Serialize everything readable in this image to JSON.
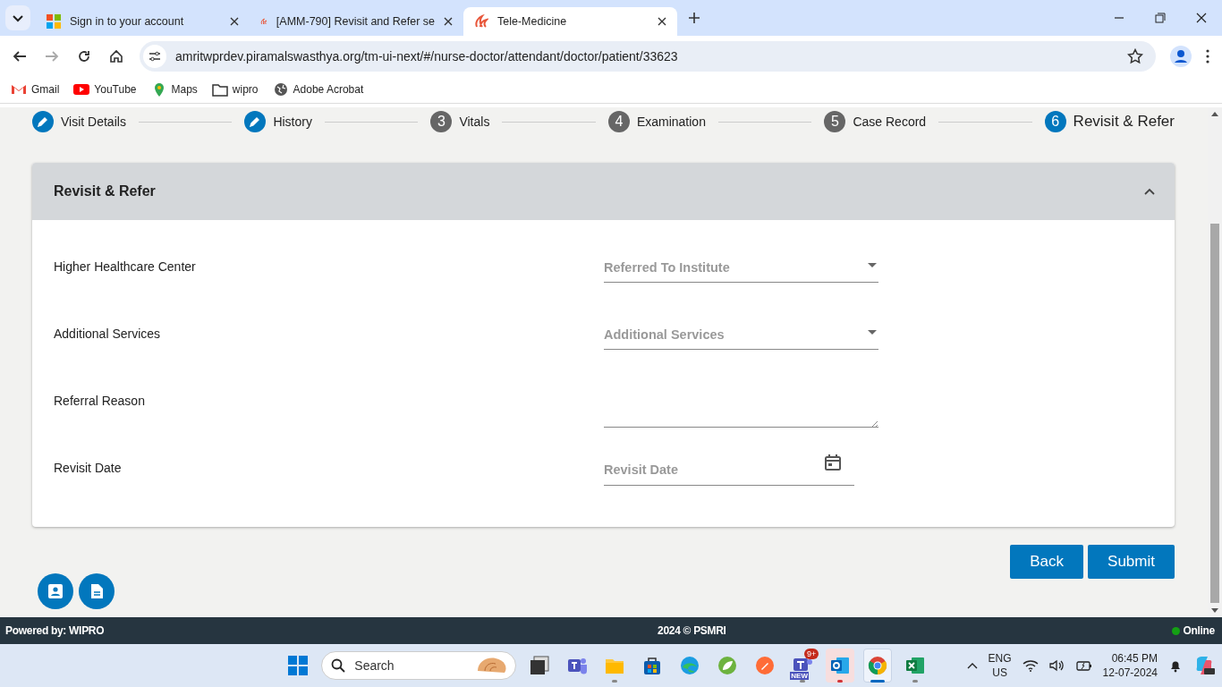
{
  "browser": {
    "tabs": [
      {
        "title": "Sign in to your account",
        "selected": false
      },
      {
        "title": "[AMM-790] Revisit and Refer se",
        "selected": false
      },
      {
        "title": "Tele-Medicine",
        "selected": true
      }
    ],
    "url": "amritwprdev.piramalswasthya.org/tm-ui-next/#/nurse-doctor/attendant/doctor/patient/33623",
    "bookmarks": [
      {
        "label": "Gmail"
      },
      {
        "label": "YouTube"
      },
      {
        "label": "Maps"
      },
      {
        "label": "wipro"
      },
      {
        "label": "Adobe Acrobat"
      }
    ]
  },
  "stepper": [
    {
      "label": "Visit Details",
      "completed": true,
      "selected": false
    },
    {
      "label": "History",
      "completed": true,
      "selected": false
    },
    {
      "label": "Vitals",
      "number": "3",
      "completed": false,
      "selected": false
    },
    {
      "label": "Examination",
      "number": "4",
      "completed": false,
      "selected": false
    },
    {
      "label": "Case Record",
      "number": "5",
      "completed": false,
      "selected": false
    },
    {
      "label": "Revisit & Refer",
      "number": "6",
      "completed": false,
      "selected": true
    }
  ],
  "panel": {
    "title": "Revisit & Refer",
    "expanded": true,
    "fields": [
      {
        "label": "Higher Healthcare Center",
        "kind": "select",
        "placeholder": "Referred To Institute"
      },
      {
        "label": "Additional Services",
        "kind": "select",
        "placeholder": "Additional Services"
      },
      {
        "label": "Referral Reason",
        "kind": "textarea"
      },
      {
        "label": "Revisit Date",
        "kind": "date",
        "placeholder": "Revisit Date"
      }
    ]
  },
  "buttons": [
    "Back",
    "Submit"
  ],
  "footer": {
    "left": "Powered by: WIPRO",
    "center": "2024 © PSMRI",
    "status": "Online",
    "online": true
  },
  "taskbar": {
    "search_placeholder": "Search",
    "apps": [
      {
        "running": false,
        "selected": false,
        "attention": false
      },
      {
        "running": false,
        "selected": false,
        "attention": false
      },
      {
        "running": true,
        "selected": false,
        "attention": false
      },
      {
        "running": false,
        "selected": false,
        "attention": false
      },
      {
        "running": false,
        "selected": false,
        "attention": false
      },
      {
        "running": false,
        "selected": false,
        "attention": false
      },
      {
        "running": false,
        "selected": false,
        "attention": false
      },
      {
        "running": true,
        "selected": false,
        "attention": false,
        "badge": "9+",
        "tag": "NEW"
      },
      {
        "running": true,
        "selected": false,
        "attention": true
      },
      {
        "running": true,
        "selected": true,
        "attention": false
      },
      {
        "running": true,
        "selected": false,
        "attention": false
      }
    ],
    "language": "ENG",
    "region": "US",
    "time": "06:45 PM",
    "date": "12-07-2024"
  }
}
